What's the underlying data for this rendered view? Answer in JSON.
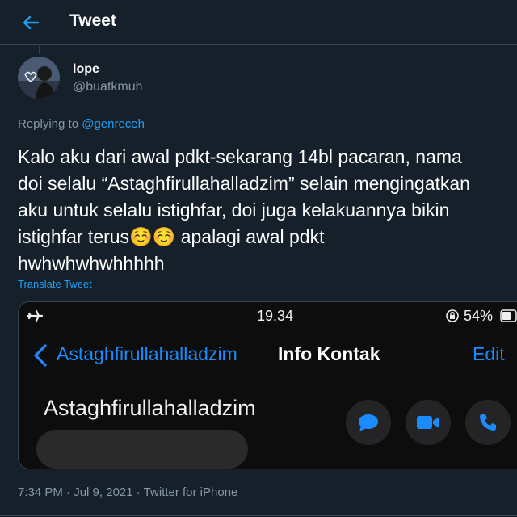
{
  "header": {
    "title": "Tweet",
    "back_icon": "arrow-left-icon"
  },
  "author": {
    "display_name": "lope",
    "handle": "@buatkmuh"
  },
  "reply": {
    "prefix": "Replying to",
    "mention": "@genreceh"
  },
  "tweet": {
    "text": "Kalo aku dari awal pdkt-sekarang 14bl pacaran, nama\ndoi selalu “Astaghfirullahalladzim” selain mengingatkan\naku untuk selalu istighfar, doi juga kelakuannya bikin\nistighfar terus☺️☺️ apalagi awal pdkt\nhwhwhwhwhhhhh",
    "translate_label": "Translate Tweet"
  },
  "media": {
    "status_bar": {
      "time": "19.34",
      "battery": "54%"
    },
    "nav": {
      "back_label": "Astaghfirullahalladzim",
      "title": "Info Kontak",
      "edit_label": "Edit"
    },
    "contact_name": "Astaghfirullahalladzim",
    "actions": [
      "message-icon",
      "video-icon",
      "phone-icon"
    ]
  },
  "meta": {
    "time": "7:34 PM",
    "date": "Jul 9, 2021",
    "source": "Twitter for iPhone",
    "separator": " · "
  },
  "colors": {
    "background": "#15202b",
    "accent": "#1da1f2",
    "secondary_text": "#8899a6",
    "ios_blue": "#1a8cff"
  }
}
